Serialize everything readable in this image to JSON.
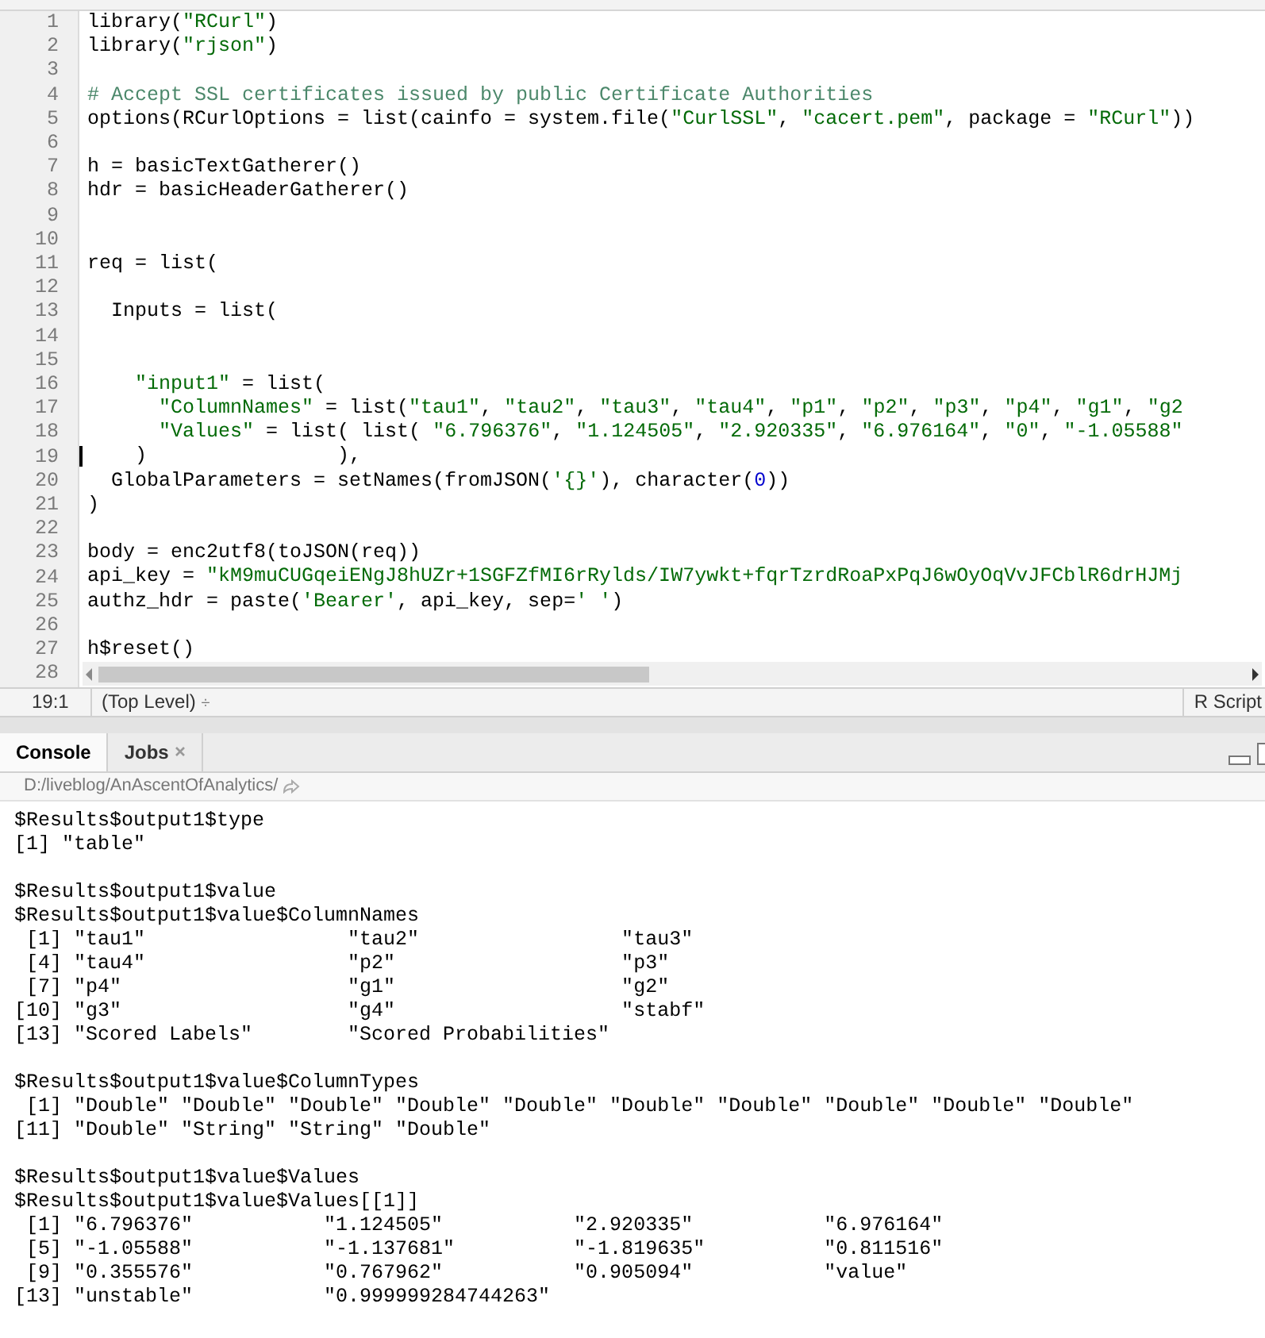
{
  "editor": {
    "lines": [
      {
        "number": "1",
        "segments": [
          {
            "kind": "code",
            "text": "library("
          },
          {
            "kind": "string",
            "text": "\"RCurl\""
          },
          {
            "kind": "code",
            "text": ")"
          }
        ]
      },
      {
        "number": "2",
        "segments": [
          {
            "kind": "code",
            "text": "library("
          },
          {
            "kind": "string",
            "text": "\"rjson\""
          },
          {
            "kind": "code",
            "text": ")"
          }
        ]
      },
      {
        "number": "3"
      },
      {
        "number": "4",
        "segments": [
          {
            "kind": "comment",
            "text": "# Accept SSL certificates issued by public Certificate Authorities"
          }
        ]
      },
      {
        "number": "5",
        "segments": [
          {
            "kind": "code",
            "text": "options(RCurlOptions = list(cainfo = system.file("
          },
          {
            "kind": "string",
            "text": "\"CurlSSL\""
          },
          {
            "kind": "code",
            "text": ", "
          },
          {
            "kind": "string",
            "text": "\"cacert.pem\""
          },
          {
            "kind": "code",
            "text": ", package = "
          },
          {
            "kind": "string",
            "text": "\"RCurl\""
          },
          {
            "kind": "code",
            "text": "))"
          }
        ]
      },
      {
        "number": "6"
      },
      {
        "number": "7",
        "segments": [
          {
            "kind": "code",
            "text": "h = basicTextGatherer()"
          }
        ]
      },
      {
        "number": "8",
        "segments": [
          {
            "kind": "code",
            "text": "hdr = basicHeaderGatherer()"
          }
        ]
      },
      {
        "number": "9"
      },
      {
        "number": "10"
      },
      {
        "number": "11",
        "segments": [
          {
            "kind": "code",
            "text": "req = list("
          }
        ]
      },
      {
        "number": "12"
      },
      {
        "number": "13",
        "segments": [
          {
            "kind": "code",
            "text": "  Inputs = list("
          }
        ]
      },
      {
        "number": "14"
      },
      {
        "number": "15"
      },
      {
        "number": "16",
        "segments": [
          {
            "kind": "string",
            "text": "    \"input1\""
          },
          {
            "kind": "code",
            "text": " = list("
          }
        ]
      },
      {
        "number": "17",
        "segments": [
          {
            "kind": "string",
            "text": "      \"ColumnNames\""
          },
          {
            "kind": "code",
            "text": " = list("
          },
          {
            "kind": "string",
            "text": "\"tau1\""
          },
          {
            "kind": "code",
            "text": ", "
          },
          {
            "kind": "string",
            "text": "\"tau2\""
          },
          {
            "kind": "code",
            "text": ", "
          },
          {
            "kind": "string",
            "text": "\"tau3\""
          },
          {
            "kind": "code",
            "text": ", "
          },
          {
            "kind": "string",
            "text": "\"tau4\""
          },
          {
            "kind": "code",
            "text": ", "
          },
          {
            "kind": "string",
            "text": "\"p1\""
          },
          {
            "kind": "code",
            "text": ", "
          },
          {
            "kind": "string",
            "text": "\"p2\""
          },
          {
            "kind": "code",
            "text": ", "
          },
          {
            "kind": "string",
            "text": "\"p3\""
          },
          {
            "kind": "code",
            "text": ", "
          },
          {
            "kind": "string",
            "text": "\"p4\""
          },
          {
            "kind": "code",
            "text": ", "
          },
          {
            "kind": "string",
            "text": "\"g1\""
          },
          {
            "kind": "code",
            "text": ", "
          },
          {
            "kind": "string",
            "text": "\"g2"
          }
        ]
      },
      {
        "number": "18",
        "segments": [
          {
            "kind": "string",
            "text": "      \"Values\""
          },
          {
            "kind": "code",
            "text": " = list( list( "
          },
          {
            "kind": "string",
            "text": "\"6.796376\""
          },
          {
            "kind": "code",
            "text": ", "
          },
          {
            "kind": "string",
            "text": "\"1.124505\""
          },
          {
            "kind": "code",
            "text": ", "
          },
          {
            "kind": "string",
            "text": "\"2.920335\""
          },
          {
            "kind": "code",
            "text": ", "
          },
          {
            "kind": "string",
            "text": "\"6.976164\""
          },
          {
            "kind": "code",
            "text": ", "
          },
          {
            "kind": "string",
            "text": "\"0\""
          },
          {
            "kind": "code",
            "text": ", "
          },
          {
            "kind": "string",
            "text": "\"-1.05588\""
          }
        ]
      },
      {
        "number": "19",
        "cursor": true,
        "segments": [
          {
            "kind": "code",
            "text": "    )                ),"
          }
        ]
      },
      {
        "number": "20",
        "segments": [
          {
            "kind": "code",
            "text": "  GlobalParameters = setNames(fromJSON("
          },
          {
            "kind": "string",
            "text": "'{}'"
          },
          {
            "kind": "code",
            "text": "), character("
          },
          {
            "kind": "number",
            "text": "0"
          },
          {
            "kind": "code",
            "text": "))"
          }
        ]
      },
      {
        "number": "21",
        "segments": [
          {
            "kind": "code",
            "text": ")"
          }
        ]
      },
      {
        "number": "22"
      },
      {
        "number": "23",
        "segments": [
          {
            "kind": "code",
            "text": "body = enc2utf8(toJSON(req))"
          }
        ]
      },
      {
        "number": "24",
        "segments": [
          {
            "kind": "code",
            "text": "api_key = "
          },
          {
            "kind": "string",
            "text": "\"kM9muCUGqeiENgJ8hUZr+1SGFZfMI6rRylds/IW7ywkt+fqrTzrdRoaPxPqJ6wOyOqVvJFCblR6drHJMj"
          }
        ]
      },
      {
        "number": "25",
        "segments": [
          {
            "kind": "code",
            "text": "authz_hdr = paste("
          },
          {
            "kind": "string",
            "text": "'Bearer'"
          },
          {
            "kind": "code",
            "text": ", api_key, sep="
          },
          {
            "kind": "string",
            "text": "' '"
          },
          {
            "kind": "code",
            "text": ")"
          }
        ]
      },
      {
        "number": "26"
      },
      {
        "number": "27",
        "segments": [
          {
            "kind": "code",
            "text": "h$reset()"
          }
        ]
      }
    ],
    "last_line_number": "28"
  },
  "status_bar": {
    "position": "19:1",
    "scope": "(Top Level)",
    "scope_arrows": "÷",
    "file_type": "R Script"
  },
  "console_tabs": [
    {
      "label": "Console",
      "selected": true,
      "closable": false
    },
    {
      "label": "Jobs",
      "selected": false,
      "closable": true
    }
  ],
  "console": {
    "path": "D:/liveblog/AnAscentOfAnalytics/",
    "blocks": [
      [
        "$Results$output1$type",
        "[1] \"table\""
      ],
      [
        "$Results$output1$value",
        "$Results$output1$value$ColumnNames",
        " [1] \"tau1\"                 \"tau2\"                 \"tau3\"",
        " [4] \"tau4\"                 \"p2\"                   \"p3\"",
        " [7] \"p4\"                   \"g1\"                   \"g2\"",
        "[10] \"g3\"                   \"g4\"                   \"stabf\"",
        "[13] \"Scored Labels\"        \"Scored Probabilities\""
      ],
      [
        "$Results$output1$value$ColumnTypes",
        " [1] \"Double\" \"Double\" \"Double\" \"Double\" \"Double\" \"Double\" \"Double\" \"Double\" \"Double\" \"Double\"",
        "[11] \"Double\" \"String\" \"String\" \"Double\""
      ],
      [
        "$Results$output1$value$Values",
        "$Results$output1$value$Values[[1]]",
        " [1] \"6.796376\"           \"1.124505\"           \"2.920335\"           \"6.976164\"",
        " [5] \"-1.05588\"           \"-1.137681\"          \"-1.819635\"          \"0.811516\"",
        " [9] \"0.355576\"           \"0.767962\"           \"0.905094\"           \"value\"",
        "[13] \"unstable\"           \"0.999999284744263\""
      ]
    ]
  }
}
